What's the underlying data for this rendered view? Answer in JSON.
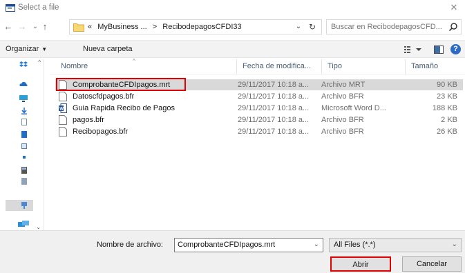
{
  "window": {
    "title": "Select a file",
    "close_symbol": "✕",
    "app_icon": "dialog-icon"
  },
  "navigation": {
    "back_icon": "arrow-left-icon",
    "forward_icon": "arrow-right-icon",
    "recent_icon": "chevron-down-icon",
    "up_icon": "arrow-up-icon",
    "breadcrumb": [
      "«",
      "MyBusiness ...",
      ">",
      "RecibodepagosCFDI33"
    ],
    "search_placeholder": "Buscar en RecibodepagosCFD..."
  },
  "toolbar": {
    "organize_label": "Organizar",
    "new_folder_label": "Nueva carpeta",
    "help_label": "?"
  },
  "columns": {
    "name": "Nombre",
    "date": "Fecha de modifica...",
    "type": "Tipo",
    "size": "Tamaño"
  },
  "files": [
    {
      "name": "ComprobanteCFDIpagos.mrt",
      "date": "29/11/2017 10:18 a...",
      "type": "Archivo MRT",
      "size": "90 KB",
      "icon": "file-icon",
      "selected": true
    },
    {
      "name": "Datoscfdpagos.bfr",
      "date": "29/11/2017 10:18 a...",
      "type": "Archivo BFR",
      "size": "23 KB",
      "icon": "file-icon",
      "selected": false
    },
    {
      "name": "Guia Rapida Recibo de Pagos",
      "date": "29/11/2017 10:18 a...",
      "type": "Microsoft Word D...",
      "size": "188 KB",
      "icon": "word-document-icon",
      "selected": false
    },
    {
      "name": "pagos.bfr",
      "date": "29/11/2017 10:18 a...",
      "type": "Archivo BFR",
      "size": "2 KB",
      "icon": "file-icon",
      "selected": false
    },
    {
      "name": "Recibopagos.bfr",
      "date": "29/11/2017 10:18 a...",
      "type": "Archivo BFR",
      "size": "26 KB",
      "icon": "file-icon",
      "selected": false
    }
  ],
  "footer": {
    "filename_label": "Nombre de archivo:",
    "filename_value": "ComprobanteCFDIpagos.mrt",
    "filter_value": "All Files (*.*)",
    "open_label": "Abrir",
    "cancel_label": "Cancelar"
  },
  "colors": {
    "highlight": "#e00000",
    "accent": "#2d6bc5",
    "selection": "#d9d9d9"
  }
}
